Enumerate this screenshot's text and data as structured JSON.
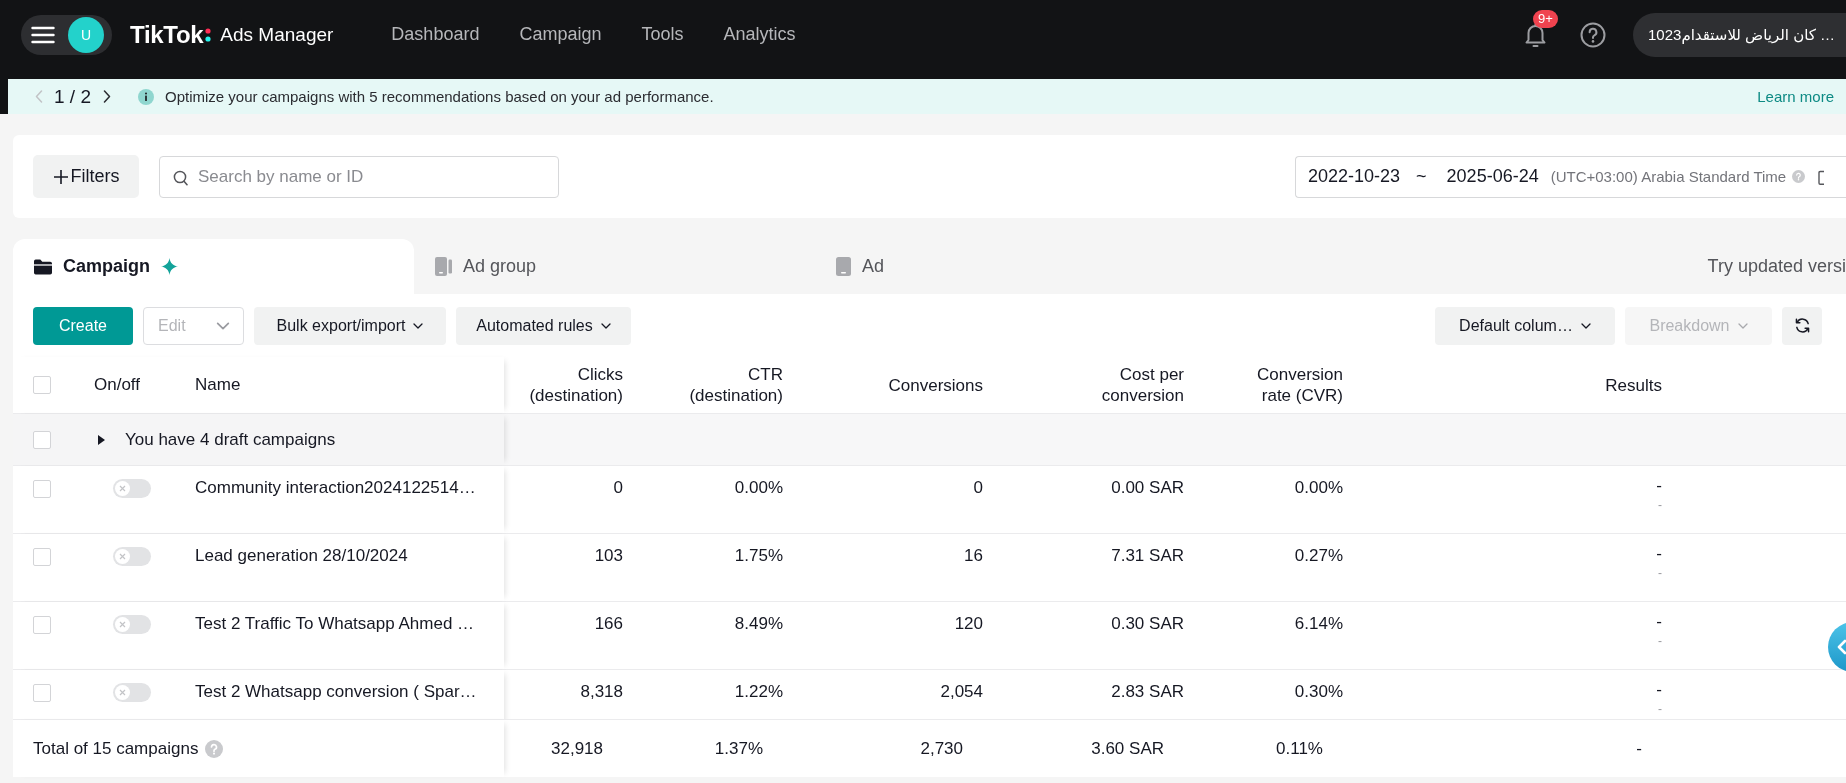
{
  "top_bar": {
    "avatar": "U",
    "logo": "TikTok",
    "product": "Ads Manager",
    "nav": [
      "Dashboard",
      "Campaign",
      "Tools",
      "Analytics"
    ],
    "notification_badge": "9+",
    "account": "كان الرياض للاستقدام1023 …"
  },
  "banner": {
    "pager": {
      "text": "1 / 2",
      "prev_disabled": true,
      "next_disabled": false
    },
    "message": "Optimize your campaigns with 5 recommendations based on your ad performance.",
    "link": "Learn more"
  },
  "filters": {
    "button": "Filters",
    "search": {
      "placeholder": "Search by name or ID"
    },
    "date_range": {
      "start": "2022-10-23",
      "separator": "~",
      "end": "2025-06-24",
      "timezone": "(UTC+03:00) Arabia Standard Time"
    }
  },
  "tabs": [
    {
      "kind": "campaign",
      "label": "Campaign",
      "selected": true,
      "sparkle": true
    },
    {
      "kind": "ad_group",
      "label": "Ad group",
      "selected": false,
      "sparkle": false
    },
    {
      "kind": "ad",
      "label": "Ad",
      "selected": false,
      "sparkle": false
    }
  ],
  "tabs_link": "Try updated versi",
  "toolbar": {
    "left": [
      {
        "kind": "primary",
        "label": "Create",
        "disabled": false
      },
      {
        "kind": "select",
        "label": "Edit",
        "disabled": true
      },
      {
        "kind": "menu",
        "label": "Bulk export/import",
        "disabled": false
      },
      {
        "kind": "menu",
        "label": "Automated rules",
        "disabled": false
      }
    ],
    "right": [
      {
        "kind": "menu",
        "label": "Default colum…",
        "disabled": false
      },
      {
        "kind": "menu",
        "label": "Breakdown",
        "disabled": true
      },
      {
        "kind": "refresh",
        "disabled": false
      }
    ]
  },
  "table": {
    "select_all": false,
    "columns": [
      "On/off",
      "Name",
      "Clicks (destination)",
      "CTR (destination)",
      "Conversions",
      "Cost per conversion",
      "Conversion rate (CVR)",
      "Results"
    ],
    "draft_row": {
      "label": "You have 4 draft campaigns",
      "checked": false,
      "expanded": false
    },
    "rows": [
      {
        "checked": false,
        "on": false,
        "name": "Community interaction2024122514…",
        "values": [
          "0",
          "0.00%",
          "0",
          "0.00 SAR",
          "0.00%"
        ],
        "result": "-",
        "result_note": "-"
      },
      {
        "checked": false,
        "on": false,
        "name": "Lead generation 28/10/2024",
        "values": [
          "103",
          "1.75%",
          "16",
          "7.31 SAR",
          "0.27%"
        ],
        "result": "-",
        "result_note": "-"
      },
      {
        "checked": false,
        "on": false,
        "name": "Test 2 Traffic To Whatsapp Ahmed …",
        "values": [
          "166",
          "8.49%",
          "120",
          "0.30 SAR",
          "6.14%"
        ],
        "result": "-",
        "result_note": "-"
      },
      {
        "checked": false,
        "on": false,
        "name": "Test 2 Whatsapp conversion ( Spar…",
        "values": [
          "8,318",
          "1.22%",
          "2,054",
          "2.83 SAR",
          "0.30%"
        ],
        "result": "-",
        "result_note": "-"
      }
    ],
    "total": {
      "label": "Total of 15 campaigns",
      "values": [
        "32,918",
        "1.37%",
        "2,730",
        "3.60 SAR",
        "0.11%",
        "-"
      ]
    }
  }
}
